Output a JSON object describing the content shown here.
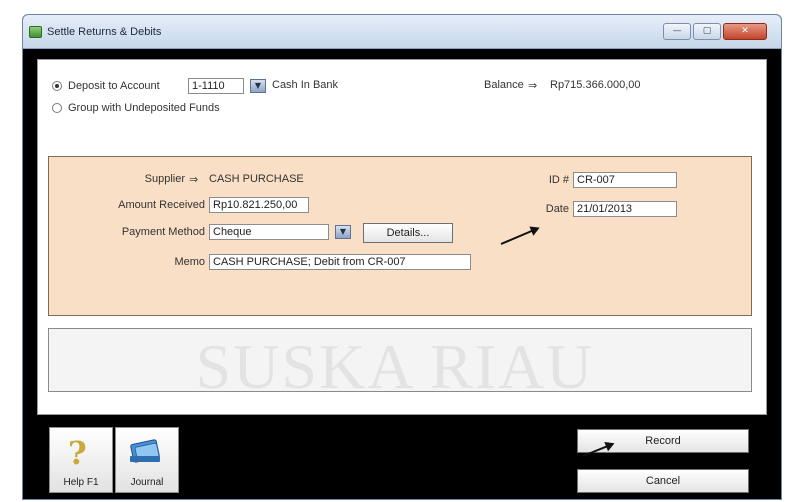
{
  "window": {
    "title": "Settle Returns & Debits",
    "min": "—",
    "max": "▢",
    "close": "✕"
  },
  "deposit": {
    "deposit_label": "Deposit to Account",
    "account_number": "1-1110",
    "account_name": "Cash In Bank",
    "group_label": "Group with Undeposited Funds",
    "balance_label": "Balance",
    "balance_value": "Rp715.366.000,00"
  },
  "form": {
    "supplier_label": "Supplier",
    "supplier_value": "CASH PURCHASE",
    "amount_label": "Amount Received",
    "amount_value": "Rp10.821.250,00",
    "payment_method_label": "Payment Method",
    "payment_method_value": "Cheque",
    "details_label": "Details...",
    "memo_label": "Memo",
    "memo_value": "CASH PURCHASE; Debit from CR-007",
    "id_label": "ID #",
    "id_value": "CR-007",
    "date_label": "Date",
    "date_value": "21/01/2013"
  },
  "icons": {
    "right_arrow": "⇒",
    "dropdown": "▼",
    "help": "?",
    "journal": "📗"
  },
  "toolbar": {
    "help_label": "Help F1",
    "journal_label": "Journal"
  },
  "actions": {
    "record_label": "Record",
    "cancel_label": "Cancel"
  },
  "watermark": "SUSKA RIAU",
  "colors": {
    "panel_accent": "#f9dfc5",
    "title_bar": "#c7d7ea",
    "close_button": "#c2442b"
  }
}
